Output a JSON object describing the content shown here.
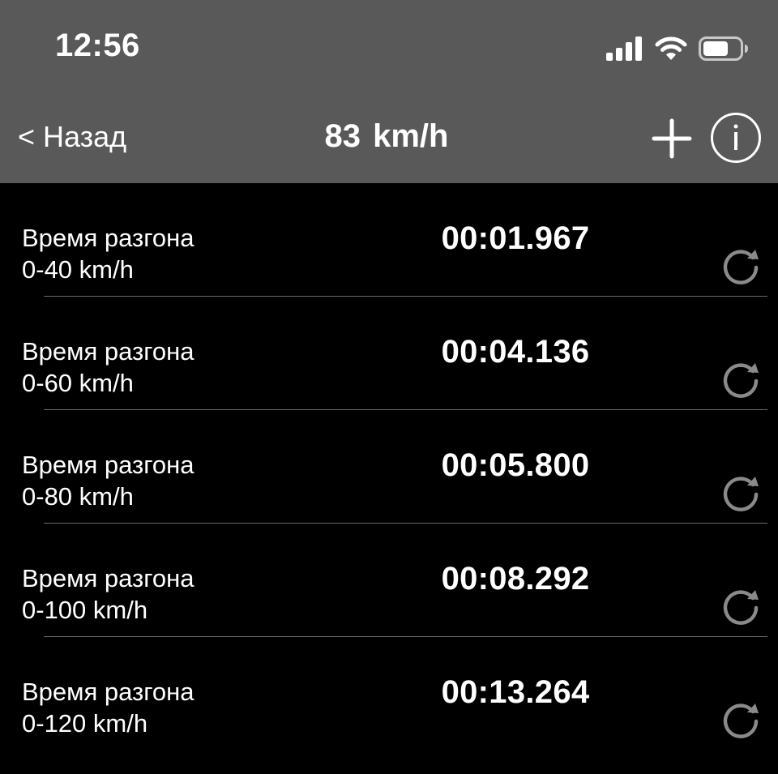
{
  "status_bar": {
    "time": "12:56",
    "icons": [
      "cellular-signal-icon",
      "wifi-icon",
      "battery-icon"
    ]
  },
  "nav": {
    "back_label": "< Назад",
    "title": "83 km/h",
    "add_icon": "plus-icon",
    "info_icon": "info-icon"
  },
  "colors": {
    "header_bg": "#595959",
    "list_bg": "#000000",
    "text": "#ffffff",
    "reset_icon": "#8a8a8a",
    "divider": "#6a6a6a"
  },
  "rows": [
    {
      "title": "Время разгона",
      "range": "0-40 km/h",
      "time": "00:01.967",
      "reset_icon": "reload-icon"
    },
    {
      "title": "Время разгона",
      "range": "0-60 km/h",
      "time": "00:04.136",
      "reset_icon": "reload-icon"
    },
    {
      "title": "Время разгона",
      "range": "0-80 km/h",
      "time": "00:05.800",
      "reset_icon": "reload-icon"
    },
    {
      "title": "Время разгона",
      "range": "0-100 km/h",
      "time": "00:08.292",
      "reset_icon": "reload-icon"
    },
    {
      "title": "Время разгона",
      "range": "0-120 km/h",
      "time": "00:13.264",
      "reset_icon": "reload-icon"
    }
  ]
}
